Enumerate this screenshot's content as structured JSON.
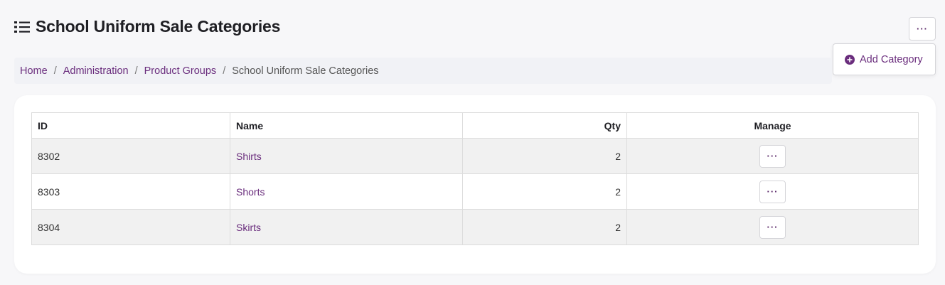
{
  "header": {
    "title": "School Uniform Sale Categories",
    "icon": "list-icon",
    "more_icon": "ellipsis-icon",
    "more_label": "···"
  },
  "actions_menu": {
    "items": [
      {
        "label": "Add Category",
        "icon": "plus-circle-icon"
      }
    ]
  },
  "breadcrumb": {
    "items": [
      "Home",
      "Administration",
      "Product Groups"
    ],
    "current": "School Uniform Sale Categories",
    "separator": "/"
  },
  "table": {
    "columns": [
      "ID",
      "Name",
      "Qty",
      "Manage"
    ],
    "rows": [
      {
        "id": "8302",
        "name": "Shirts",
        "qty": "2",
        "manage_label": "···"
      },
      {
        "id": "8303",
        "name": "Shorts",
        "qty": "2",
        "manage_label": "···"
      },
      {
        "id": "8304",
        "name": "Skirts",
        "qty": "2",
        "manage_label": "···"
      }
    ]
  },
  "colors": {
    "accent": "#6a2d7d",
    "background": "#f7f7f9",
    "row_stripe": "#f1f1f1"
  }
}
